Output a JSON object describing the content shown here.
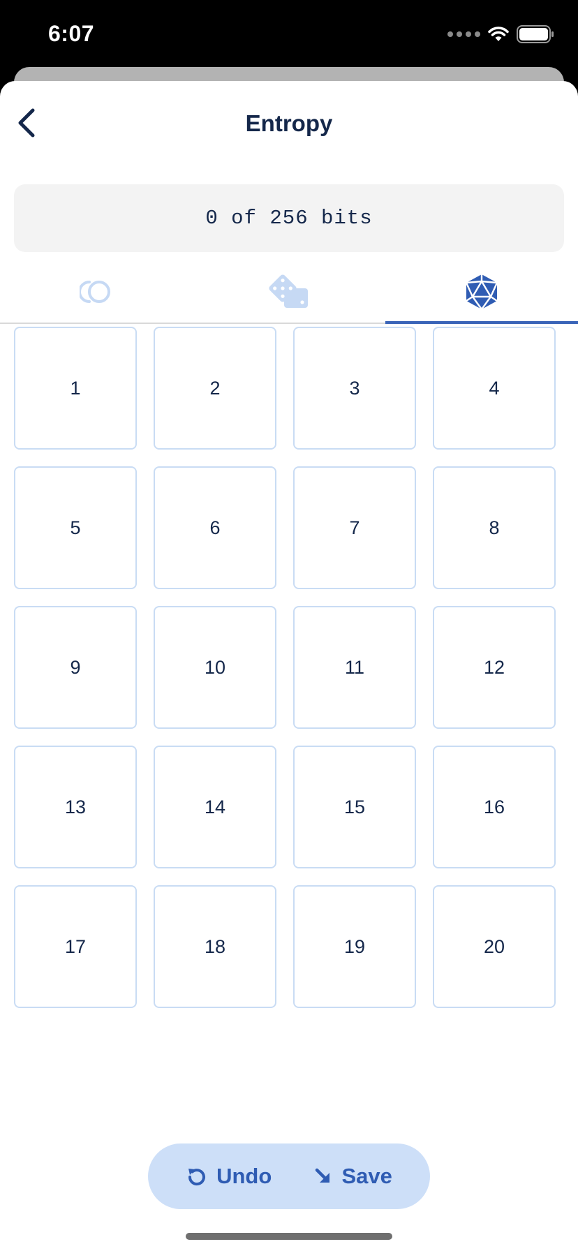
{
  "status_bar": {
    "time": "6:07"
  },
  "nav": {
    "title": "Entropy",
    "back_icon": "chevron-left-icon"
  },
  "bits_display": "0 of 256 bits",
  "tabs": [
    {
      "icon": "coin-icon",
      "active": false
    },
    {
      "icon": "dice-icon",
      "active": false
    },
    {
      "icon": "d20-icon",
      "active": true
    }
  ],
  "grid": {
    "values": [
      "1",
      "2",
      "3",
      "4",
      "5",
      "6",
      "7",
      "8",
      "9",
      "10",
      "11",
      "12",
      "13",
      "14",
      "15",
      "16",
      "17",
      "18",
      "19",
      "20"
    ]
  },
  "actions": {
    "undo_label": "Undo",
    "save_label": "Save"
  },
  "colors": {
    "accent": "#3a64b8",
    "text_dark": "#14274a",
    "cell_border": "#c9dcf4",
    "pill_bg": "#cddff8",
    "tab_inactive": "#c6d9f4"
  }
}
